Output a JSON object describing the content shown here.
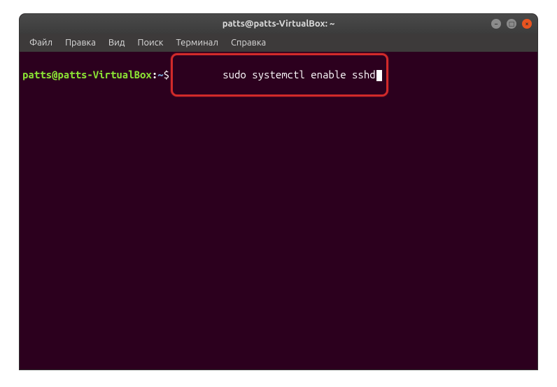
{
  "window": {
    "title": "patts@patts-VirtualBox: ~"
  },
  "menubar": {
    "items": [
      {
        "label": "Файл"
      },
      {
        "label": "Правка"
      },
      {
        "label": "Вид"
      },
      {
        "label": "Поиск"
      },
      {
        "label": "Терминал"
      },
      {
        "label": "Справка"
      }
    ]
  },
  "terminal": {
    "prompt": {
      "user_host": "patts@patts-VirtualBox",
      "colon": ":",
      "path": "~",
      "symbol": "$"
    },
    "command": "sudo systemctl enable sshd"
  },
  "colors": {
    "bg": "#2c001e",
    "prompt_user": "#8ae234",
    "prompt_path": "#729fcf",
    "text": "#ffffff",
    "highlight_border": "#d12a2a",
    "close_btn": "#e95420"
  }
}
